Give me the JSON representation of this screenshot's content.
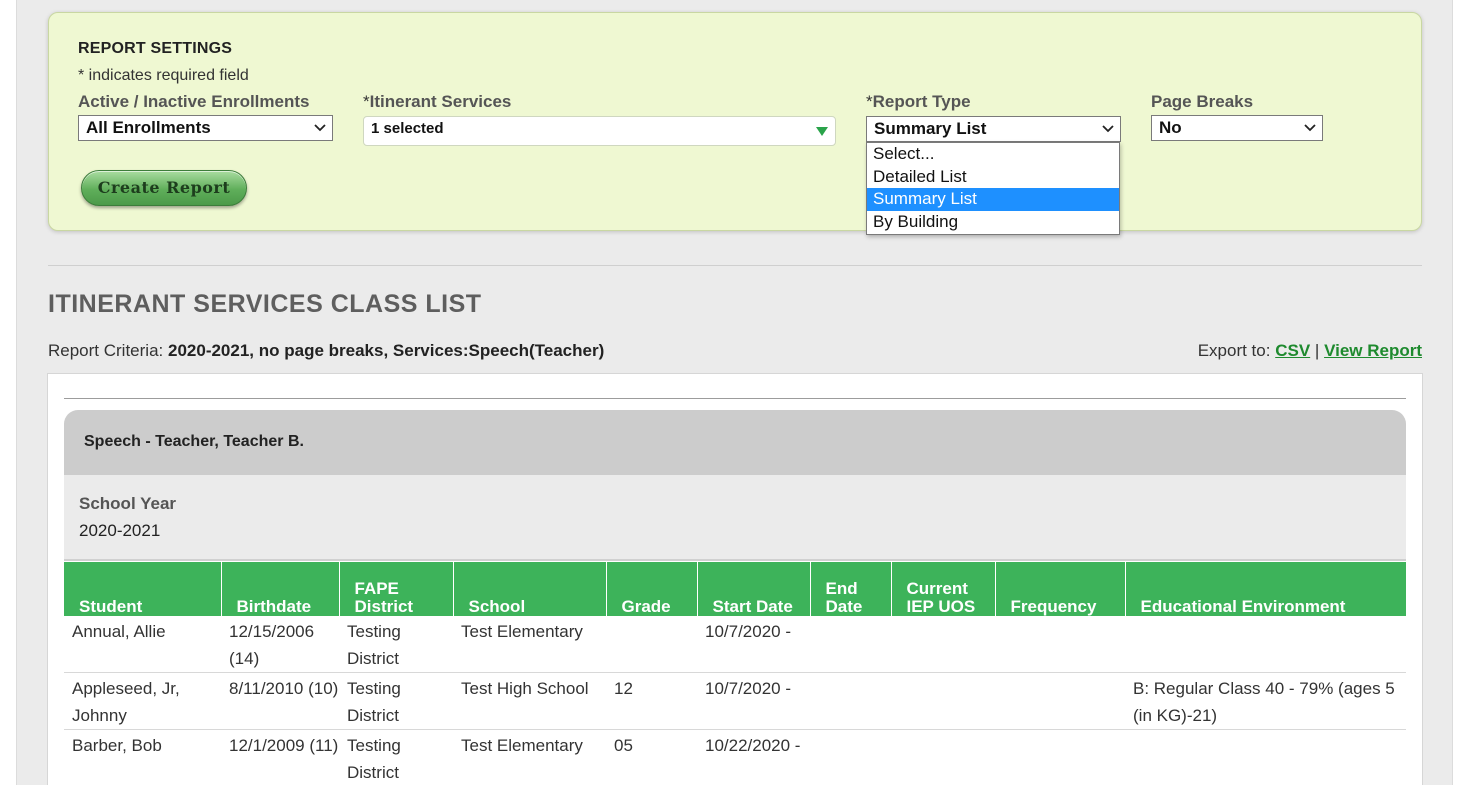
{
  "settings": {
    "title": "REPORT SETTINGS",
    "required_note": "* indicates required field",
    "enrollments": {
      "label": "Active / Inactive Enrollments",
      "value": "All Enrollments"
    },
    "services": {
      "label": "Itinerant Services",
      "required_mark": "*",
      "value": "1 selected"
    },
    "report_type": {
      "label": "Report Type",
      "required_mark": "*",
      "value": "Summary List",
      "options": [
        "Select...",
        "Detailed List",
        "Summary List",
        "By Building"
      ],
      "selected_index": 2
    },
    "page_breaks": {
      "label": "Page Breaks",
      "value": "No"
    },
    "create_button": "Create Report"
  },
  "report": {
    "title": "ITINERANT SERVICES CLASS LIST",
    "criteria_label": "Report Criteria:",
    "criteria_value": "2020-2021, no page breaks, Services:Speech(Teacher)",
    "export_label": "Export to:",
    "export_csv": "CSV",
    "export_separator": "|",
    "export_view": "View Report",
    "group_header": "Speech - Teacher, Teacher B.",
    "school_year_label": "School Year",
    "school_year_value": "2020-2021",
    "columns": [
      "Student",
      "Birthdate",
      "FAPE District",
      "School",
      "Grade",
      "Start Date",
      "End Date",
      "Current IEP UOS",
      "Frequency",
      "Educational Environment"
    ],
    "rows": [
      [
        "Annual, Allie",
        "12/15/2006 (14)",
        "Testing District",
        "Test Elementary",
        "",
        "10/7/2020 -",
        "",
        "",
        "",
        ""
      ],
      [
        "Appleseed, Jr, Johnny",
        "8/11/2010 (10)",
        "Testing District",
        "Test High School",
        "12",
        "10/7/2020 -",
        "",
        "",
        "",
        "B: Regular Class 40 - 79% (ages 5 (in KG)-21)"
      ],
      [
        "Barber, Bob",
        "12/1/2009 (11)",
        "Testing District",
        "Test Elementary",
        "05",
        "10/22/2020 -",
        "",
        "",
        "",
        ""
      ]
    ]
  }
}
